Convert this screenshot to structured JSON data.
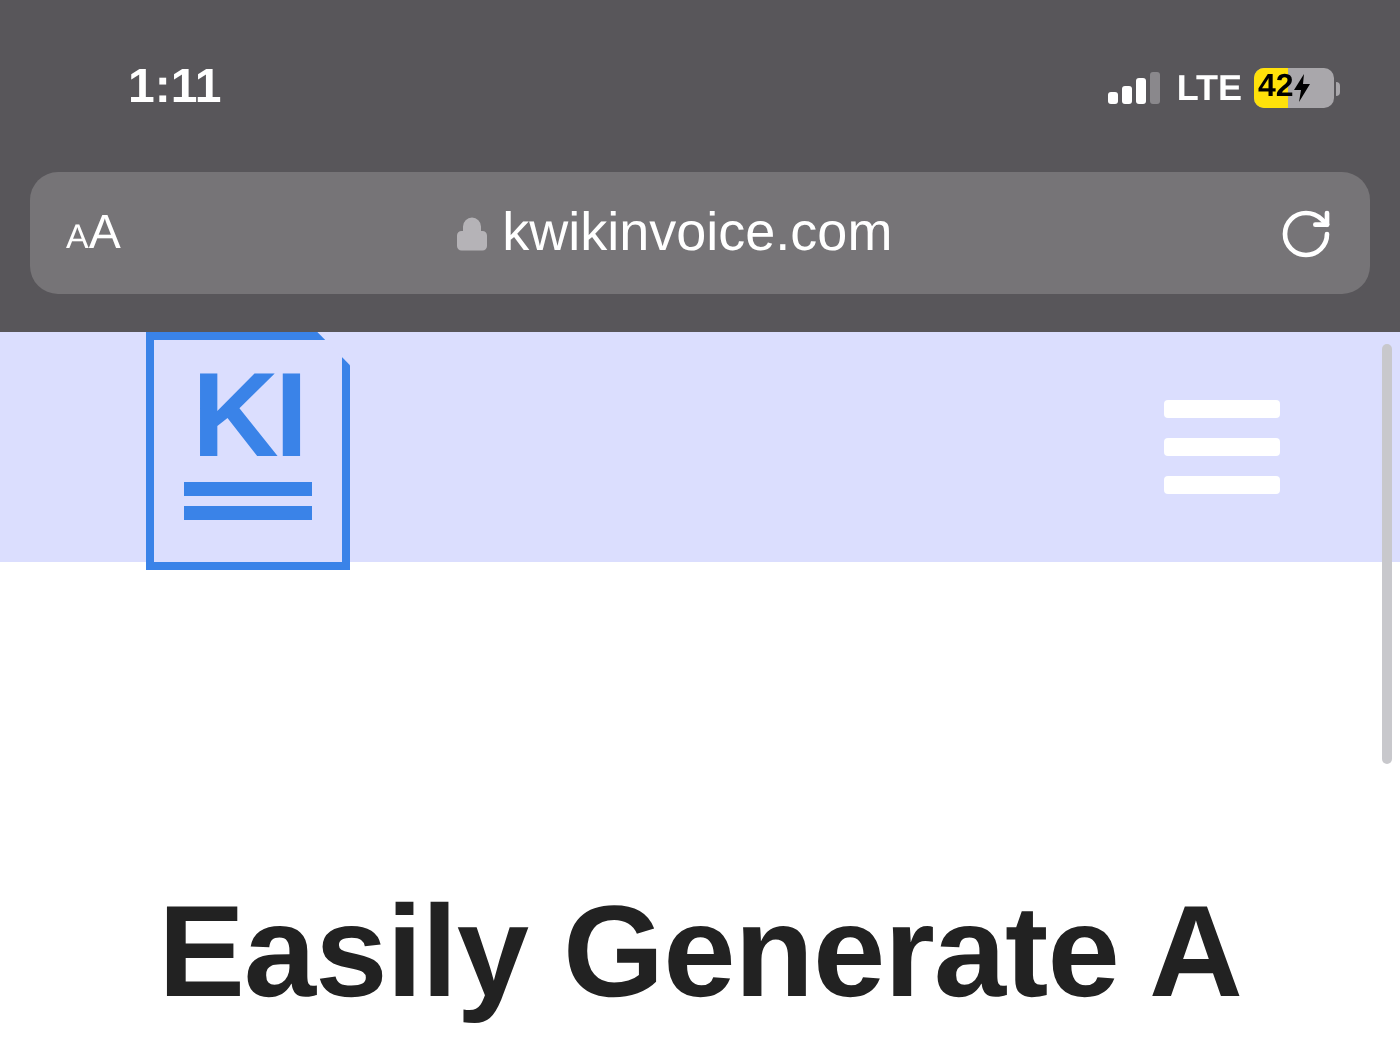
{
  "status_bar": {
    "time": "1:11",
    "network": "LTE",
    "battery": "42"
  },
  "address_bar": {
    "text_size": "AA",
    "url": "kwikinvoice.com"
  },
  "header": {
    "logo": "KI"
  },
  "hero": {
    "heading": "Easily Generate A"
  }
}
